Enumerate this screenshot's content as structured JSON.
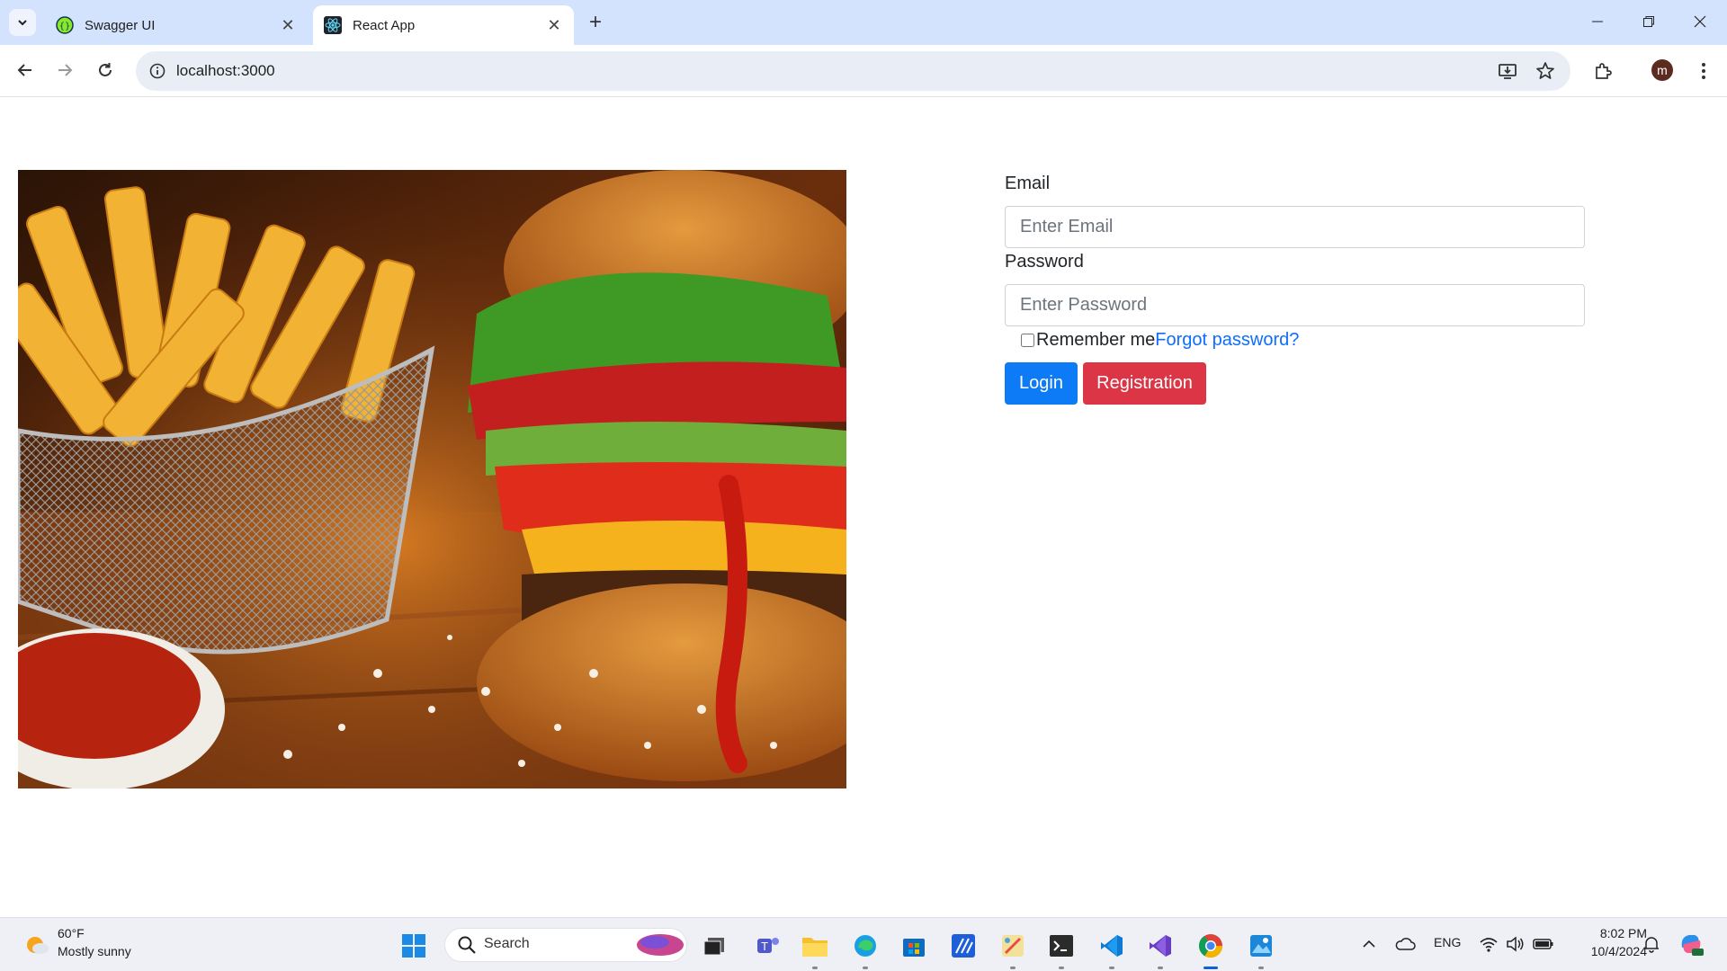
{
  "browser": {
    "tabs": [
      {
        "title": "Swagger UI",
        "icon": "swagger-favicon-icon",
        "active": false
      },
      {
        "title": "React App",
        "icon": "react-favicon-icon",
        "active": true
      }
    ],
    "url": "localhost:3000",
    "profile_initial": "m"
  },
  "login_form": {
    "email_label": "Email",
    "email_placeholder": "Enter Email",
    "password_label": "Password",
    "password_placeholder": "Enter Password",
    "remember_label": "Remember me",
    "forgot_link": "Forgot password?",
    "login_button": "Login",
    "registration_button": "Registration"
  },
  "image": {
    "alt": "Burger and fries",
    "icon": "food-photo"
  },
  "taskbar": {
    "weather_temp": "60°F",
    "weather_desc": "Mostly sunny",
    "search_label": "Search",
    "language": "ENG",
    "time": "8:02 PM",
    "date": "10/4/2024",
    "apps": [
      "start-icon",
      "task-view-icon",
      "teams-icon",
      "file-explorer-icon",
      "edge-icon",
      "store-icon",
      "vs-code-alt-icon",
      "paint-icon",
      "terminal-icon",
      "vscode-icon",
      "visual-studio-icon",
      "chrome-icon",
      "photos-icon"
    ]
  },
  "colors": {
    "primary": "#0d7bf6",
    "danger": "#dc3545",
    "link": "#0d6efd",
    "tabstrip": "#d3e3fd"
  }
}
